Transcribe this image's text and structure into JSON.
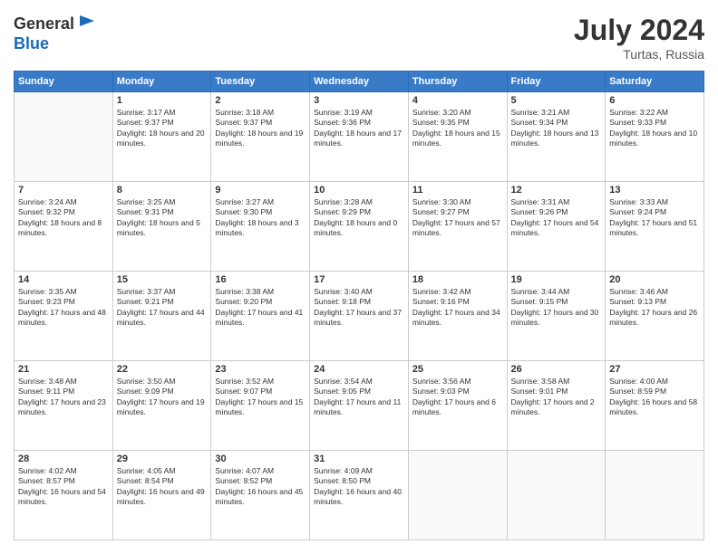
{
  "header": {
    "logo_general": "General",
    "logo_blue": "Blue",
    "month_year": "July 2024",
    "location": "Turtas, Russia"
  },
  "days_of_week": [
    "Sunday",
    "Monday",
    "Tuesday",
    "Wednesday",
    "Thursday",
    "Friday",
    "Saturday"
  ],
  "weeks": [
    [
      {
        "day": "",
        "empty": true
      },
      {
        "day": "1",
        "sunrise": "3:17 AM",
        "sunset": "9:37 PM",
        "daylight": "18 hours and 20 minutes."
      },
      {
        "day": "2",
        "sunrise": "3:18 AM",
        "sunset": "9:37 PM",
        "daylight": "18 hours and 19 minutes."
      },
      {
        "day": "3",
        "sunrise": "3:19 AM",
        "sunset": "9:36 PM",
        "daylight": "18 hours and 17 minutes."
      },
      {
        "day": "4",
        "sunrise": "3:20 AM",
        "sunset": "9:35 PM",
        "daylight": "18 hours and 15 minutes."
      },
      {
        "day": "5",
        "sunrise": "3:21 AM",
        "sunset": "9:34 PM",
        "daylight": "18 hours and 13 minutes."
      },
      {
        "day": "6",
        "sunrise": "3:22 AM",
        "sunset": "9:33 PM",
        "daylight": "18 hours and 10 minutes."
      }
    ],
    [
      {
        "day": "7",
        "sunrise": "3:24 AM",
        "sunset": "9:32 PM",
        "daylight": "18 hours and 8 minutes."
      },
      {
        "day": "8",
        "sunrise": "3:25 AM",
        "sunset": "9:31 PM",
        "daylight": "18 hours and 5 minutes."
      },
      {
        "day": "9",
        "sunrise": "3:27 AM",
        "sunset": "9:30 PM",
        "daylight": "18 hours and 3 minutes."
      },
      {
        "day": "10",
        "sunrise": "3:28 AM",
        "sunset": "9:29 PM",
        "daylight": "18 hours and 0 minutes."
      },
      {
        "day": "11",
        "sunrise": "3:30 AM",
        "sunset": "9:27 PM",
        "daylight": "17 hours and 57 minutes."
      },
      {
        "day": "12",
        "sunrise": "3:31 AM",
        "sunset": "9:26 PM",
        "daylight": "17 hours and 54 minutes."
      },
      {
        "day": "13",
        "sunrise": "3:33 AM",
        "sunset": "9:24 PM",
        "daylight": "17 hours and 51 minutes."
      }
    ],
    [
      {
        "day": "14",
        "sunrise": "3:35 AM",
        "sunset": "9:23 PM",
        "daylight": "17 hours and 48 minutes."
      },
      {
        "day": "15",
        "sunrise": "3:37 AM",
        "sunset": "9:21 PM",
        "daylight": "17 hours and 44 minutes."
      },
      {
        "day": "16",
        "sunrise": "3:38 AM",
        "sunset": "9:20 PM",
        "daylight": "17 hours and 41 minutes."
      },
      {
        "day": "17",
        "sunrise": "3:40 AM",
        "sunset": "9:18 PM",
        "daylight": "17 hours and 37 minutes."
      },
      {
        "day": "18",
        "sunrise": "3:42 AM",
        "sunset": "9:16 PM",
        "daylight": "17 hours and 34 minutes."
      },
      {
        "day": "19",
        "sunrise": "3:44 AM",
        "sunset": "9:15 PM",
        "daylight": "17 hours and 30 minutes."
      },
      {
        "day": "20",
        "sunrise": "3:46 AM",
        "sunset": "9:13 PM",
        "daylight": "17 hours and 26 minutes."
      }
    ],
    [
      {
        "day": "21",
        "sunrise": "3:48 AM",
        "sunset": "9:11 PM",
        "daylight": "17 hours and 23 minutes."
      },
      {
        "day": "22",
        "sunrise": "3:50 AM",
        "sunset": "9:09 PM",
        "daylight": "17 hours and 19 minutes."
      },
      {
        "day": "23",
        "sunrise": "3:52 AM",
        "sunset": "9:07 PM",
        "daylight": "17 hours and 15 minutes."
      },
      {
        "day": "24",
        "sunrise": "3:54 AM",
        "sunset": "9:05 PM",
        "daylight": "17 hours and 11 minutes."
      },
      {
        "day": "25",
        "sunrise": "3:56 AM",
        "sunset": "9:03 PM",
        "daylight": "17 hours and 6 minutes."
      },
      {
        "day": "26",
        "sunrise": "3:58 AM",
        "sunset": "9:01 PM",
        "daylight": "17 hours and 2 minutes."
      },
      {
        "day": "27",
        "sunrise": "4:00 AM",
        "sunset": "8:59 PM",
        "daylight": "16 hours and 58 minutes."
      }
    ],
    [
      {
        "day": "28",
        "sunrise": "4:02 AM",
        "sunset": "8:57 PM",
        "daylight": "16 hours and 54 minutes."
      },
      {
        "day": "29",
        "sunrise": "4:05 AM",
        "sunset": "8:54 PM",
        "daylight": "16 hours and 49 minutes."
      },
      {
        "day": "30",
        "sunrise": "4:07 AM",
        "sunset": "8:52 PM",
        "daylight": "16 hours and 45 minutes."
      },
      {
        "day": "31",
        "sunrise": "4:09 AM",
        "sunset": "8:50 PM",
        "daylight": "16 hours and 40 minutes."
      },
      {
        "day": "",
        "empty": true
      },
      {
        "day": "",
        "empty": true
      },
      {
        "day": "",
        "empty": true
      }
    ]
  ]
}
